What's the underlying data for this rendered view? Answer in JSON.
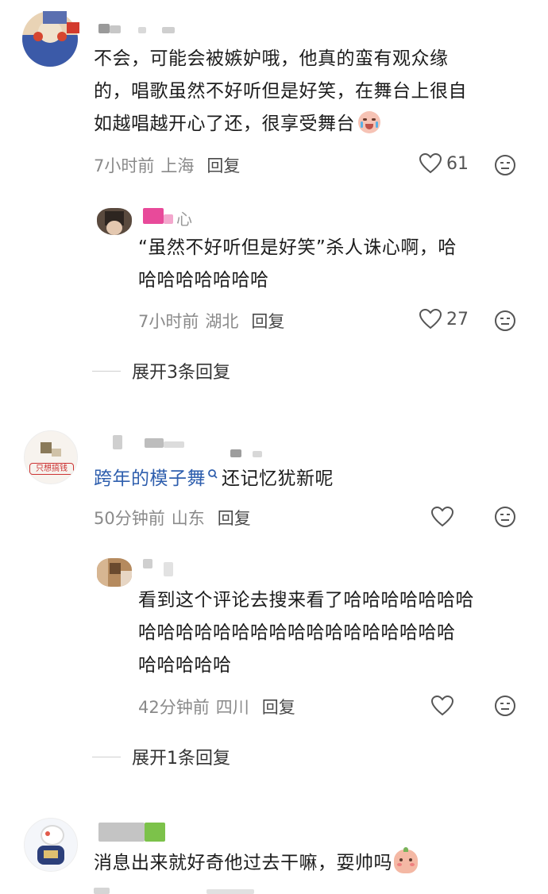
{
  "comments": [
    {
      "text_lines": [
        "不会，可能会被嫉妒哦，他真的蛮有观众缘",
        "的，唱歌虽然不好听但是好笑，在舞台上很自",
        "如越唱越开心了还，很享受舞台"
      ],
      "time": "7小时前",
      "location": "上海",
      "reply_label": "回复",
      "likes": "61",
      "replies": [
        {
          "username": "心",
          "text_lines": [
            "“虽然不好听但是好笑”杀人诛心啊，哈",
            "哈哈哈哈哈哈哈"
          ],
          "time": "7小时前",
          "location": "湖北",
          "reply_label": "回复",
          "likes": "27"
        }
      ],
      "expand_label": "展开3条回复"
    },
    {
      "link_text": "跨年的模子舞",
      "text_after": "还记忆犹新呢",
      "time": "50分钟前",
      "location": "山东",
      "reply_label": "回复",
      "avatar_text": "只想搞钱",
      "replies": [
        {
          "text_lines": [
            "看到这个评论去搜来看了哈哈哈哈哈哈哈",
            "哈哈哈哈哈哈哈哈哈哈哈哈哈哈哈哈哈",
            "哈哈哈哈哈"
          ],
          "time": "42分钟前",
          "location": "四川",
          "reply_label": "回复"
        }
      ],
      "expand_label": "展开1条回复"
    },
    {
      "text": "消息出来就好奇他过去干嘛，耍帅吗"
    }
  ],
  "colors": {
    "link": "#2f5fae",
    "meta": "#8a8a8a",
    "text": "#1c1c1c"
  }
}
